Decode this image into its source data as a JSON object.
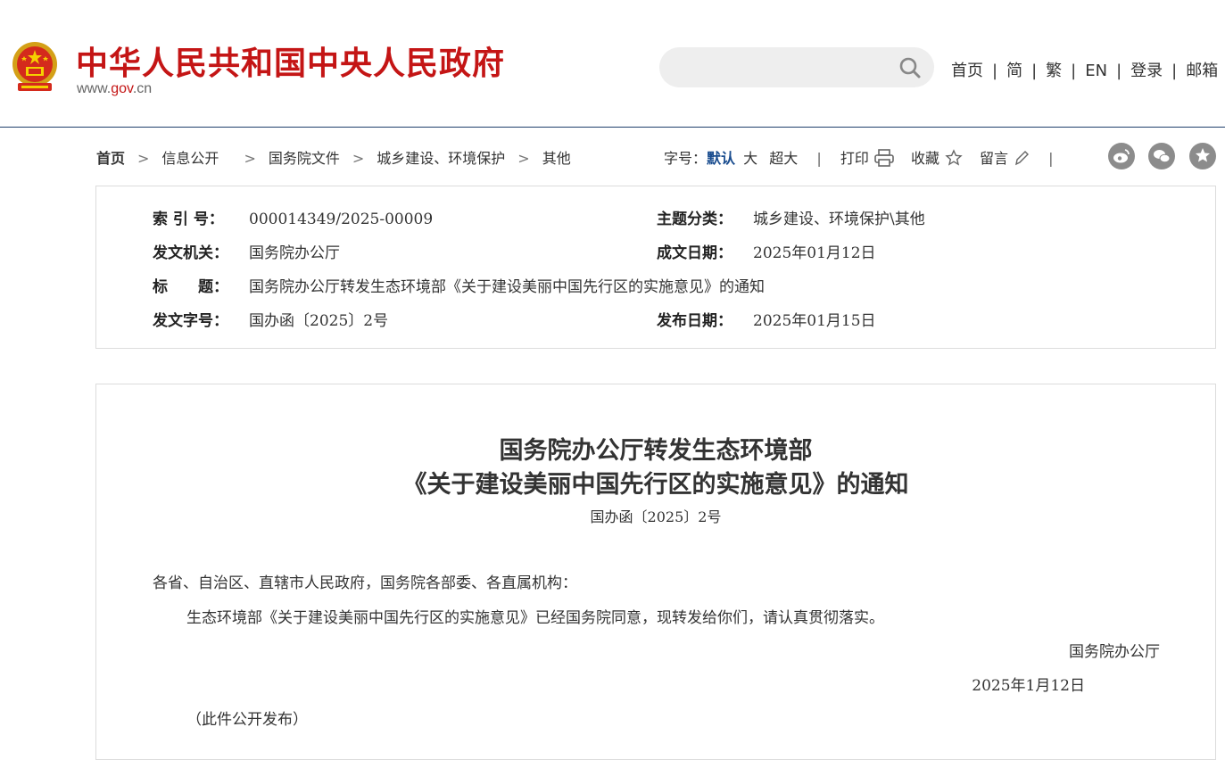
{
  "header": {
    "site_title": "中华人民共和国中央人民政府",
    "domain_prefix": "www.",
    "domain_mid": "gov",
    "domain_suffix": ".cn",
    "nav": [
      "首页",
      "简",
      "繁",
      "EN",
      "登录",
      "邮箱"
    ],
    "search": {
      "placeholder": "",
      "icon": "search-icon"
    }
  },
  "breadcrumb": [
    "首页",
    "信息公开",
    "国务院文件",
    "城乡建设、环境保护",
    "其他"
  ],
  "toolbar": {
    "font_size_label": "字号：",
    "font_default": "默认",
    "font_large": "大",
    "font_xlarge": "超大",
    "print": "打印",
    "favorite": "收藏",
    "message": "留言",
    "share_icons": [
      "weibo-icon",
      "wechat-icon",
      "more-share-icon"
    ]
  },
  "meta": {
    "index_no_label": "索 引 号：",
    "index_no": "000014349/2025-00009",
    "topic_label": "主题分类：",
    "topic": "城乡建设、环境保护\\其他",
    "issuer_label": "发文机关：",
    "issuer": "国务院办公厅",
    "written_date_label": "成文日期：",
    "written_date": "2025年01月12日",
    "title_label": "标　　题：",
    "title": "国务院办公厅转发生态环境部《关于建设美丽中国先行区的实施意见》的通知",
    "doc_no_label": "发文字号：",
    "doc_no": "国办函〔2025〕2号",
    "publish_date_label": "发布日期：",
    "publish_date": "2025年01月15日"
  },
  "article": {
    "title_line1": "国务院办公厅转发生态环境部",
    "title_line2": "《关于建设美丽中国先行区的实施意见》的通知",
    "doc_no": "国办函〔2025〕2号",
    "salutation": "各省、自治区、直辖市人民政府，国务院各部委、各直属机构：",
    "body": "生态环境部《关于建设美丽中国先行区的实施意见》已经国务院同意，现转发给你们，请认真贯彻落实。",
    "signature": "国务院办公厅",
    "date": "2025年1月12日",
    "note": "（此件公开发布）"
  },
  "colors": {
    "brand_red": "#c41515",
    "accent_blue": "#1a4d8f",
    "border": "#dcdcdc"
  }
}
